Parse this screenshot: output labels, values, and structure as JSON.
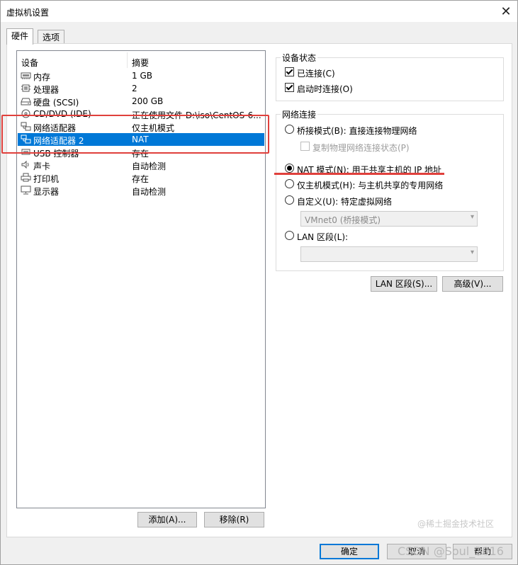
{
  "window": {
    "title": "虚拟机设置",
    "close_glyph": "✕"
  },
  "tabs": [
    {
      "label": "硬件"
    },
    {
      "label": "选项"
    }
  ],
  "device_list": {
    "col_device": "设备",
    "col_summary": "摘要",
    "rows": [
      {
        "name": "内存",
        "summary": "1 GB",
        "icon": "memory-icon"
      },
      {
        "name": "处理器",
        "summary": "2",
        "icon": "cpu-icon"
      },
      {
        "name": "硬盘 (SCSI)",
        "summary": "200 GB",
        "icon": "harddisk-icon"
      },
      {
        "name": "CD/DVD (IDE)",
        "summary": "正在使用文件 D:\\iso\\CentOS-6...",
        "icon": "cdrom-icon"
      },
      {
        "name": "网络适配器",
        "summary": "仅主机模式",
        "icon": "network-adapter-icon"
      },
      {
        "name": "网络适配器 2",
        "summary": "NAT",
        "icon": "network-adapter-icon",
        "selected": true
      },
      {
        "name": "USB 控制器",
        "summary": "存在",
        "icon": "usb-icon"
      },
      {
        "name": "声卡",
        "summary": "自动检测",
        "icon": "speaker-icon"
      },
      {
        "name": "打印机",
        "summary": "存在",
        "icon": "printer-icon"
      },
      {
        "name": "显示器",
        "summary": "自动检测",
        "icon": "monitor-icon"
      }
    ]
  },
  "buttons": {
    "add": "添加(A)...",
    "remove": "移除(R)",
    "lan_segment": "LAN 区段(S)...",
    "advanced": "高级(V)...",
    "ok": "确定",
    "cancel": "取消",
    "help": "帮助"
  },
  "device_status": {
    "legend": "设备状态",
    "connected": {
      "label": "已连接(C)",
      "checked": true
    },
    "connect_at_power_on": {
      "label": "启动时连接(O)",
      "checked": true
    }
  },
  "network_connection": {
    "legend": "网络连接",
    "bridged": {
      "label": "桥接模式(B): 直接连接物理网络",
      "selected": false
    },
    "replicate": {
      "label": "复制物理网络连接状态(P)",
      "checked": false,
      "disabled": true
    },
    "nat": {
      "label": "NAT 模式(N): 用于共享主机的 IP 地址",
      "selected": true
    },
    "host_only": {
      "label": "仅主机模式(H): 与主机共享的专用网络",
      "selected": false
    },
    "custom": {
      "label": "自定义(U): 特定虚拟网络",
      "selected": false
    },
    "custom_combo": "VMnet0 (桥接模式)",
    "lan_segment": {
      "label": "LAN 区段(L):",
      "selected": false
    },
    "lan_combo": ""
  },
  "watermarks": {
    "juejin": "@稀土掘金技术社区",
    "csdn": "CSDN @Soul_2016"
  },
  "colors": {
    "selection": "#0078d7",
    "annotation_red": "#e0403c"
  }
}
